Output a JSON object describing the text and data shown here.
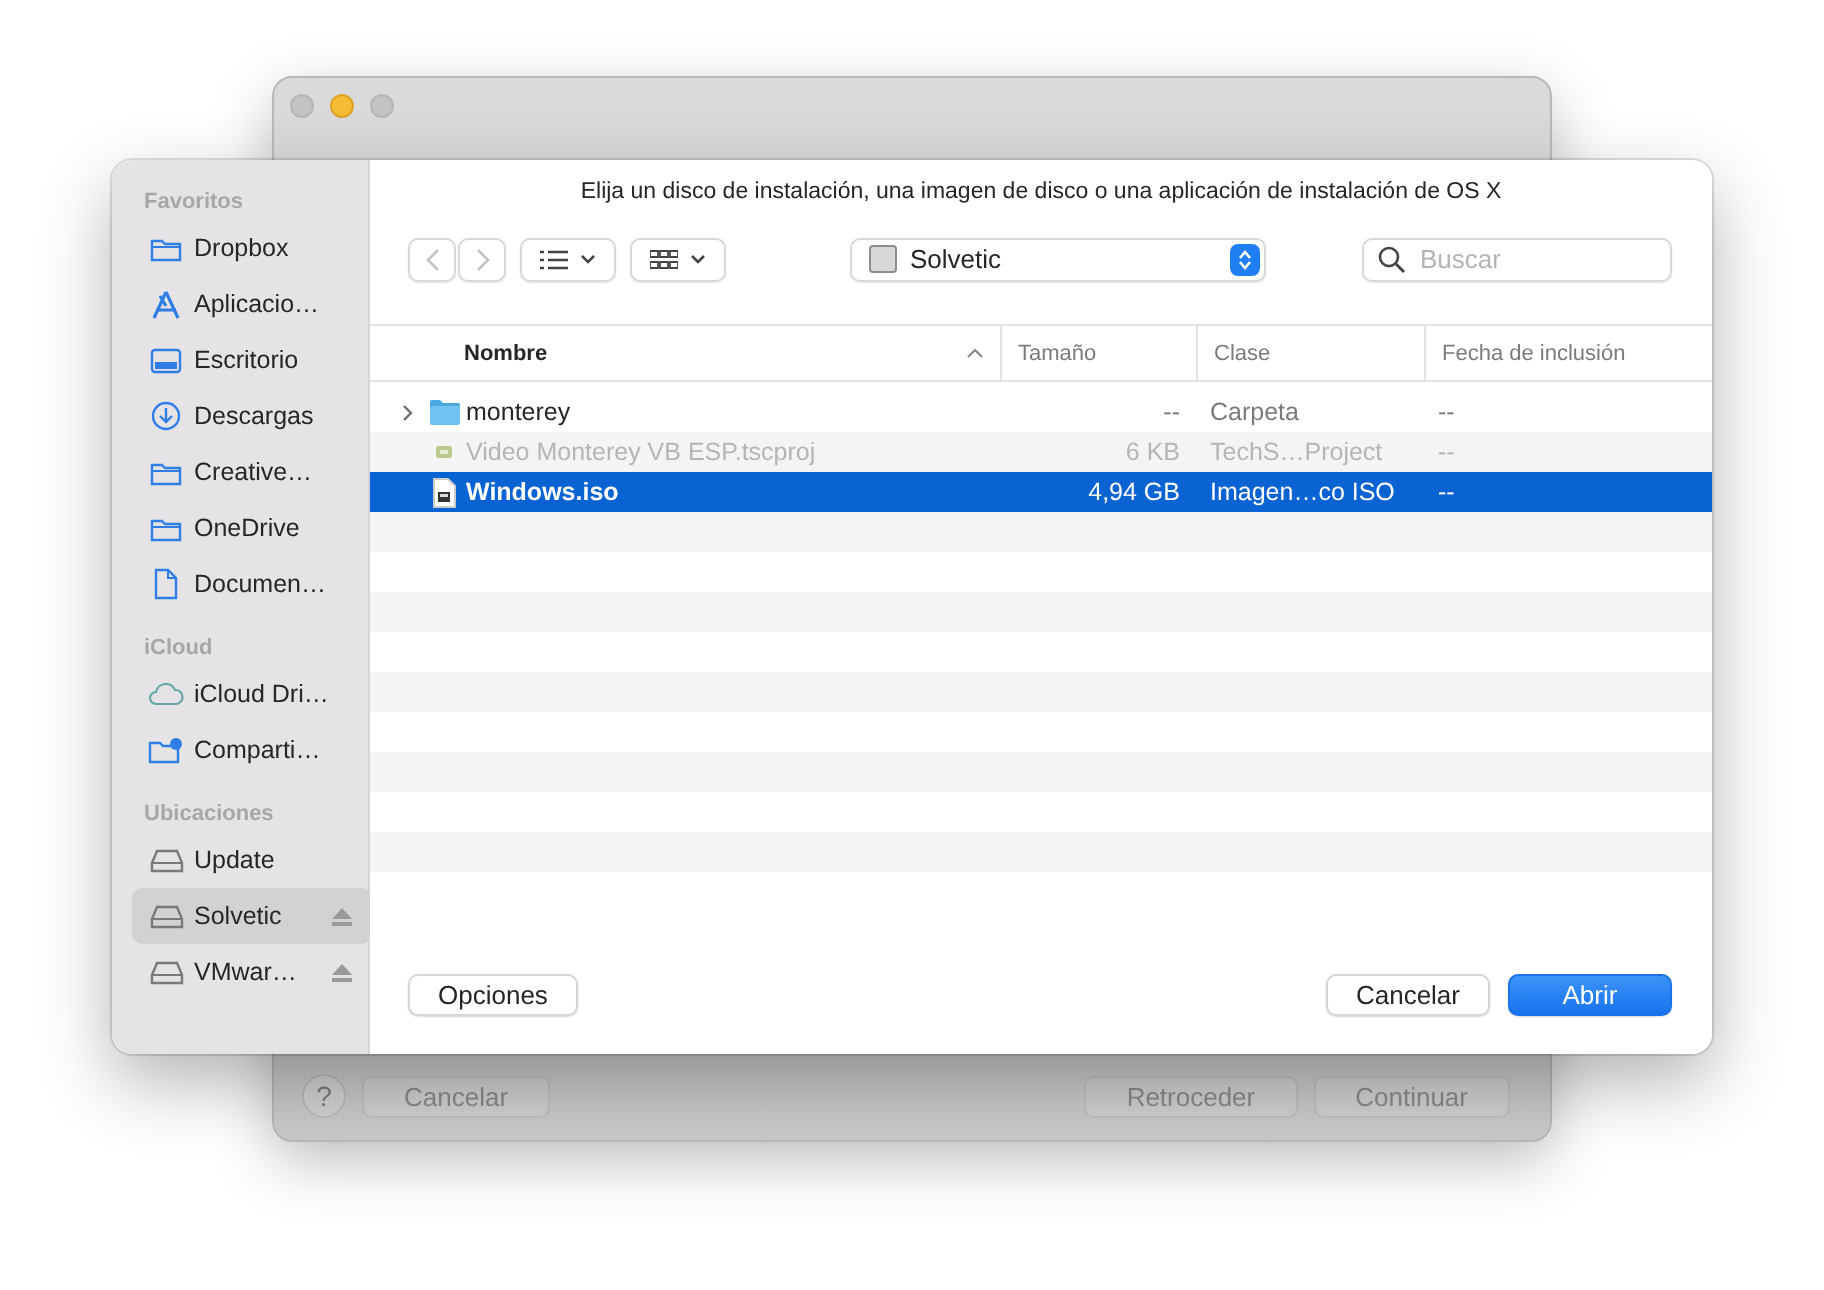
{
  "back_window": {
    "help": "?",
    "buttons": [
      {
        "label": "Cancelar"
      },
      {
        "label": "Retroceder"
      },
      {
        "label": "Continuar"
      }
    ]
  },
  "dialog": {
    "title": "Elija un disco de instalación, una imagen de disco o una aplicación de instalación de OS X",
    "sidebar": [
      {
        "heading": "Favoritos",
        "items": [
          {
            "label": "Dropbox",
            "kind": "folder",
            "selected": false,
            "eject": false
          },
          {
            "label": "Aplicacio…",
            "kind": "apps",
            "selected": false,
            "eject": false
          },
          {
            "label": "Escritorio",
            "kind": "desktop",
            "selected": false,
            "eject": false
          },
          {
            "label": "Descargas",
            "kind": "download",
            "selected": false,
            "eject": false
          },
          {
            "label": "Creative…",
            "kind": "folder",
            "selected": false,
            "eject": false
          },
          {
            "label": "OneDrive",
            "kind": "folder",
            "selected": false,
            "eject": false
          },
          {
            "label": "Documen…",
            "kind": "document",
            "selected": false,
            "eject": false
          }
        ]
      },
      {
        "heading": "iCloud",
        "items": [
          {
            "label": "iCloud Dri…",
            "kind": "cloud",
            "selected": false,
            "eject": false
          },
          {
            "label": "Comparti…",
            "kind": "shared",
            "selected": false,
            "eject": false
          }
        ]
      },
      {
        "heading": "Ubicaciones",
        "items": [
          {
            "label": "Update",
            "kind": "drive",
            "selected": false,
            "eject": false
          },
          {
            "label": "Solvetic",
            "kind": "drive",
            "selected": true,
            "eject": true
          },
          {
            "label": "VMwar…",
            "kind": "drive",
            "selected": false,
            "eject": true
          }
        ]
      }
    ],
    "location": "Solvetic",
    "search": {
      "placeholder": "Buscar"
    },
    "columns": [
      {
        "label": "Nombre",
        "sorted": true
      },
      {
        "label": "Tamaño",
        "sorted": false
      },
      {
        "label": "Clase",
        "sorted": false
      },
      {
        "label": "Fecha de inclusión",
        "sorted": false
      }
    ],
    "rows": [
      {
        "name": "monterey",
        "size": "--",
        "kind": "Carpeta",
        "date": "--",
        "expandable": true,
        "selected": false,
        "disabled": false
      },
      {
        "name": "Video Monterey VB ESP.tscproj",
        "size": "6 KB",
        "kind": "TechS…Project",
        "date": "--",
        "expandable": false,
        "selected": false,
        "disabled": true
      },
      {
        "name": "Windows.iso",
        "size": "4,94 GB",
        "kind": "Imagen…co ISO",
        "date": "--",
        "expandable": false,
        "selected": true,
        "disabled": false
      }
    ],
    "buttons": [
      {
        "label": "Opciones",
        "default": false
      },
      {
        "label": "Cancelar",
        "default": false
      },
      {
        "label": "Abrir",
        "default": true
      }
    ]
  }
}
